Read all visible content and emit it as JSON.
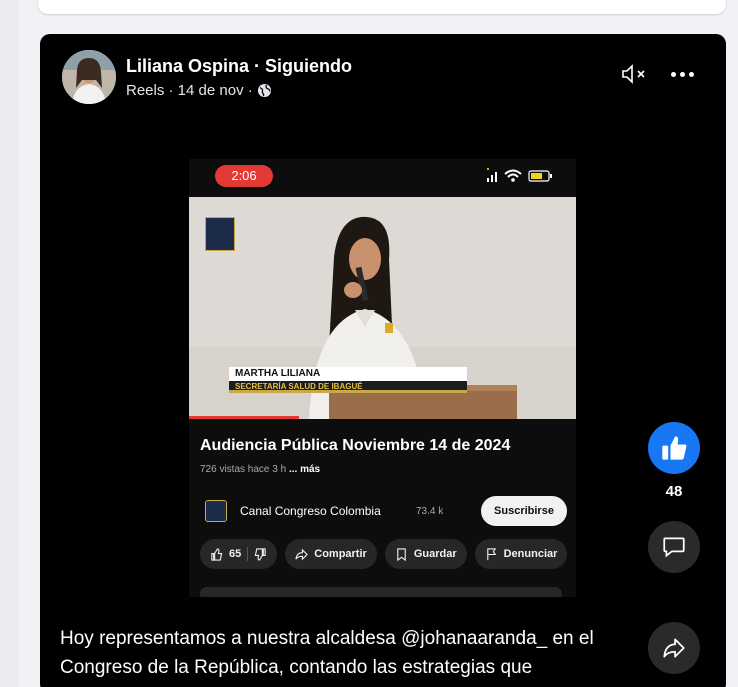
{
  "post": {
    "author": "Liliana Ospina",
    "separator": " · ",
    "follow_status": "Siguiendo",
    "meta": "Reels · 14 de nov ·",
    "caption": "Hoy representamos a nuestra alcaldesa @johanaaranda_ en el Congreso de la República, contando las estrategias que"
  },
  "reel": {
    "clock": "2:06",
    "lower_third_name": "MARTHA LILIANA",
    "lower_third_role": "SECRETARÍA SALUD DE IBAGUÉ",
    "video_title": "Audiencia Pública  Noviembre 14 de 2024",
    "views": "726 vistas  hace 3 h",
    "more_label": "... más",
    "channel_name": "Canal Congreso Colombia",
    "channel_subs": "73.4 k",
    "subscribe_label": "Suscribirse",
    "like_count": "65",
    "share_label": "Compartir",
    "save_label": "Guardar",
    "report_label": "Denunciar"
  },
  "rail": {
    "likes": "48"
  },
  "colors": {
    "like_blue": "#1877f2",
    "clock_red": "#e53935",
    "post_bg": "#000000",
    "page_bg": "#f0f2f5"
  },
  "icons": {
    "mute": "speaker-muted-icon",
    "more": "more-options-icon",
    "globe": "globe-icon",
    "like": "thumbs-up-icon",
    "comment": "comment-icon",
    "share": "share-arrow-icon"
  }
}
